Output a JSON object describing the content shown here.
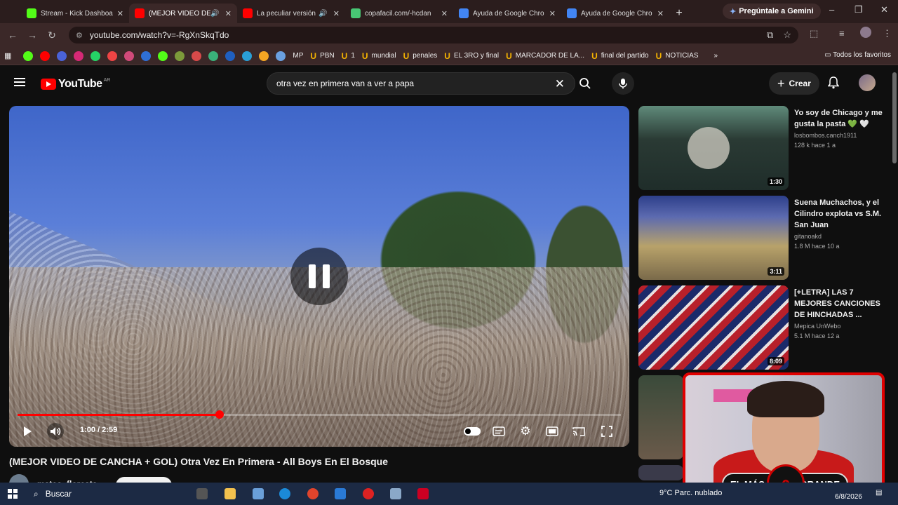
{
  "browser": {
    "tabs": [
      {
        "title": "Stream - Kick Dashboa",
        "icon": "kick-icon",
        "color": "#53fc18",
        "audio": false,
        "active": false
      },
      {
        "title": "(MEJOR VIDEO DE",
        "icon": "youtube-icon",
        "color": "#ff0000",
        "audio": true,
        "active": true
      },
      {
        "title": "La peculiar versión",
        "icon": "youtube-icon",
        "color": "#ff0000",
        "audio": true,
        "active": false
      },
      {
        "title": "copafacil.com/-hcdan",
        "icon": "globe-icon",
        "color": "#48c774",
        "audio": false,
        "active": false
      },
      {
        "title": "Ayuda de Google Chro",
        "icon": "google-icon",
        "color": "#4285f4",
        "audio": false,
        "active": false
      },
      {
        "title": "Ayuda de Google Chro",
        "icon": "google-icon",
        "color": "#4285f4",
        "audio": false,
        "active": false
      }
    ],
    "gemini_label": "Pregúntale a Gemini",
    "url": "youtube.com/watch?v=-RgXnSkqTdo",
    "bookmarks": [
      "MP",
      "PBN",
      "1",
      "mundial",
      "penales",
      "EL 3RO y final",
      "MARCADOR DE LA...",
      "final del partido",
      "NOTICIAS"
    ],
    "bookmarks_more": "»",
    "bookmarks_all": "Todos los favoritos"
  },
  "youtube": {
    "logo_text": "YouTube",
    "country_code": "AR",
    "search_query": "otra vez en primera van a ver a papa",
    "create_label": "Crear"
  },
  "player": {
    "state": "paused",
    "time": "1:00 / 2:59",
    "progress_fraction": 0.335
  },
  "video": {
    "title": "(MEJOR VIDEO DE CANCHA + GOL) Otra Vez En Primera - All Boys En El Bosque",
    "channel": "mateo_floresta"
  },
  "recommendations": [
    {
      "title": "Yo soy de Chicago y me gusta la pasta 💚 🤍",
      "channel": "losbombos.canch1911",
      "meta": "128 k  hace 1 a",
      "duration": "1:30"
    },
    {
      "title": "Suena Muchachos, y el Cilindro explota vs S.M. San Juan",
      "channel": "gitanoakd",
      "meta": "1.8 M  hace 10 a",
      "duration": "3:11"
    },
    {
      "title": "[+LETRA] LAS 7 MEJORES CANCIONES DE HINCHADAS ...",
      "channel": "Mepica UnWebo",
      "meta": "5.1 M  hace 12 a",
      "duration": "8:09"
    }
  ],
  "overlay": {
    "left_text": "EL MÁS",
    "right_text": "GRANDE"
  },
  "taskbar": {
    "search_label": "Buscar",
    "weather": "9°C  Parc. nublado",
    "date": "6/8/2026"
  }
}
